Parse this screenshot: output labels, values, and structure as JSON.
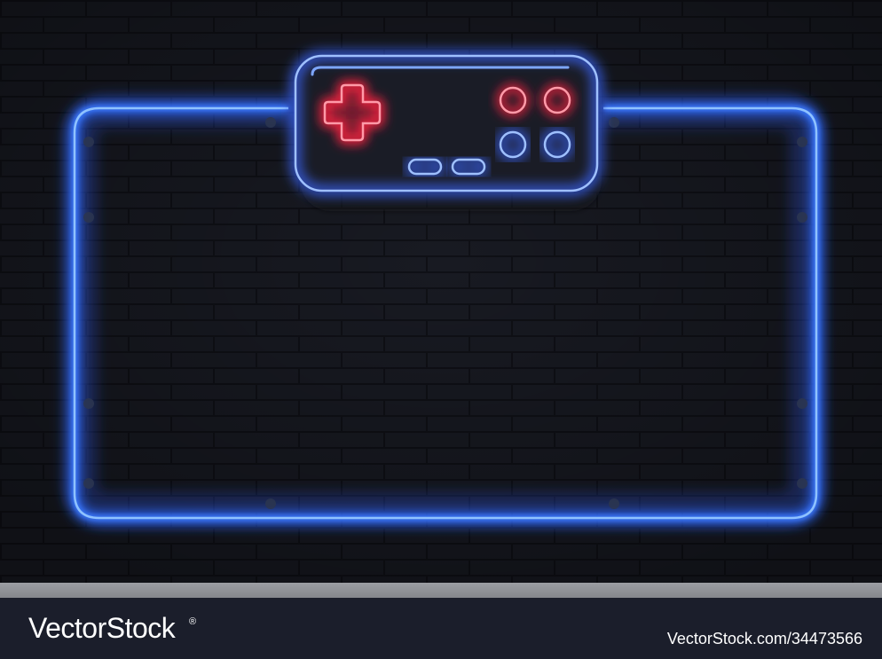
{
  "watermark": {
    "brand": "VectorStock",
    "brand_mark": "®",
    "image_id": "VectorStock.com/34473566"
  },
  "colors": {
    "wall": "#181a22",
    "mortar": "#0f1016",
    "frame_glow": "#2f6bff",
    "frame_core": "#8fc2ff",
    "controller_glow": "#3a66ff",
    "dpad_glow": "#ff2040",
    "dpad_core": "#ff9aa8",
    "footer_bg": "#1b1e2b",
    "separator": "#8f9196",
    "footer_text": "#ffffff"
  },
  "icons": {
    "controller": "gamepad-icon",
    "dpad": "dpad-icon",
    "buttons": "circle-button-icon"
  }
}
